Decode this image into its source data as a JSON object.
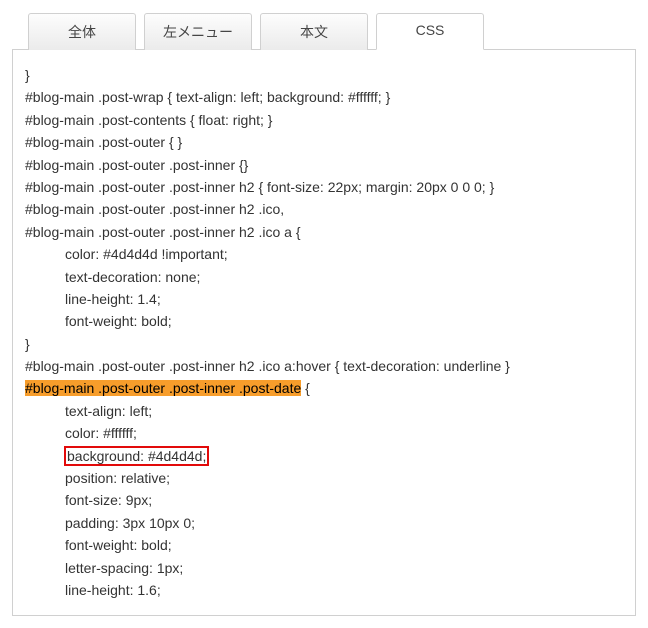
{
  "tabs": {
    "all": "全体",
    "left_menu": "左メニュー",
    "body": "本文",
    "css": "CSS"
  },
  "code": {
    "l1": "}",
    "l2": "#blog-main .post-wrap { text-align: left; background: #ffffff; }",
    "l3": "#blog-main .post-contents { float: right; }",
    "l4": "#blog-main .post-outer { }",
    "l5": "#blog-main .post-outer .post-inner {}",
    "l6": "#blog-main .post-outer .post-inner h2 { font-size: 22px; margin: 20px 0 0 0; }",
    "l7": "#blog-main .post-outer .post-inner h2 .ico,",
    "l8": "#blog-main .post-outer .post-inner h2 .ico a {",
    "l9": "color: #4d4d4d !important;",
    "l10": "text-decoration: none;",
    "l11": "line-height: 1.4;",
    "l12": "font-weight: bold;",
    "l13": "}",
    "l14": "#blog-main .post-outer .post-inner h2 .ico a:hover { text-decoration: underline }",
    "l15a": "#blog-main .post-outer .post-inner .post-date",
    "l15b": " {",
    "l16": "text-align: left;",
    "l17": "color: #ffffff;",
    "l18": "background: #4d4d4d;",
    "l19": "position: relative;",
    "l20": "font-size: 9px;",
    "l21": "padding: 3px 10px 0;",
    "l22": "font-weight: bold;",
    "l23": "letter-spacing: 1px;",
    "l24": "line-height: 1.6;"
  }
}
